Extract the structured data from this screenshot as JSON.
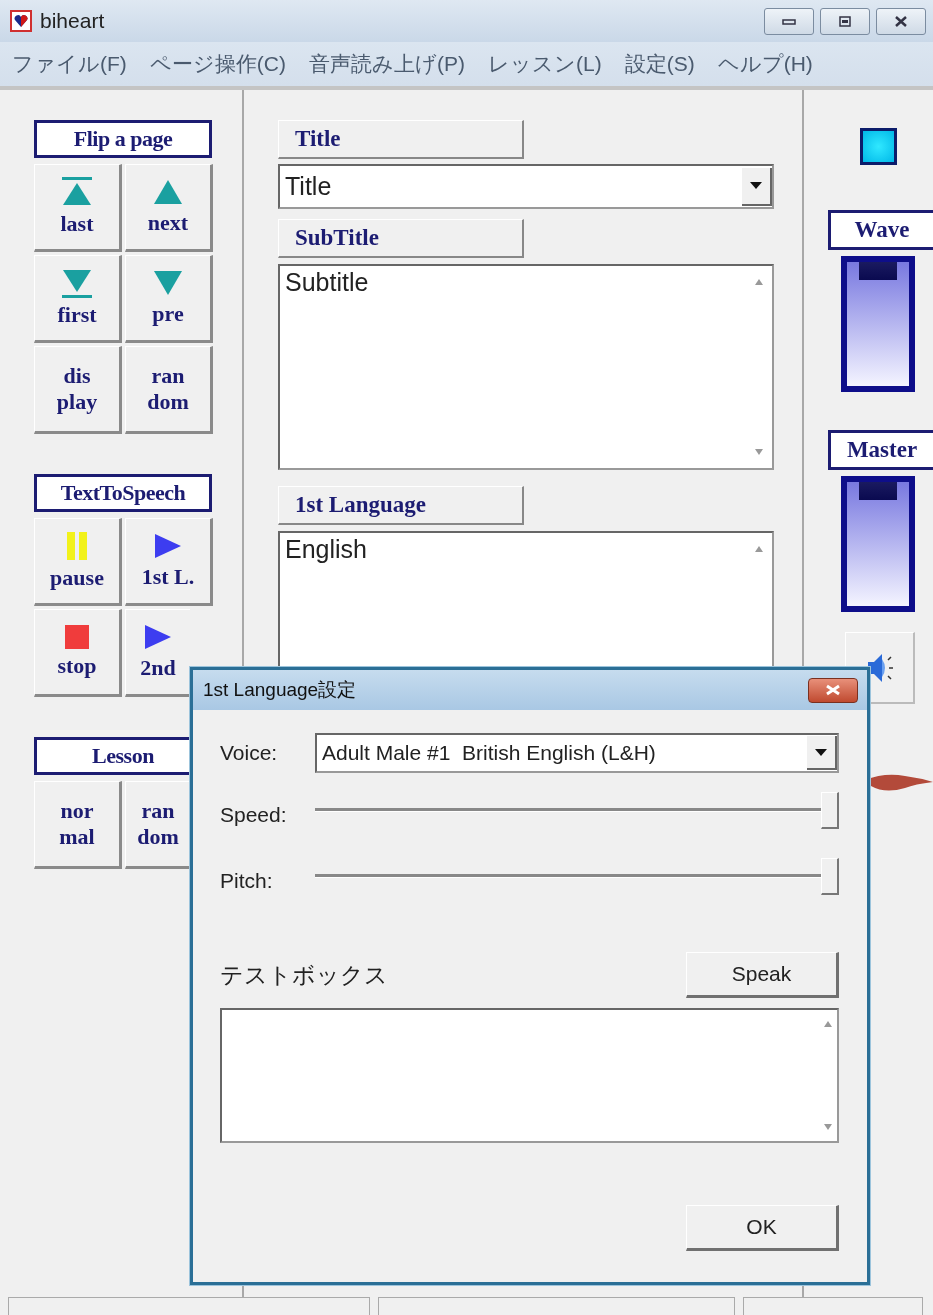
{
  "window": {
    "title": "biheart"
  },
  "menu": [
    "ファイル(F)",
    "ページ操作(C)",
    "音声読み上げ(P)",
    "レッスン(L)",
    "設定(S)",
    "ヘルプ(H)"
  ],
  "left_panel": {
    "groups": [
      {
        "title": "Flip a page",
        "buttons": [
          {
            "label": "last",
            "kind": "top"
          },
          {
            "label": "next",
            "kind": "up"
          },
          {
            "label": "first",
            "kind": "bottom"
          },
          {
            "label": "pre",
            "kind": "down"
          },
          {
            "label": "dis\nplay",
            "kind": "text"
          },
          {
            "label": "ran\ndom",
            "kind": "text"
          }
        ]
      },
      {
        "title": "TextToSpeech",
        "buttons": [
          {
            "label": "pause",
            "kind": "pause"
          },
          {
            "label": "1st L.",
            "kind": "play"
          },
          {
            "label": "stop",
            "kind": "stop"
          },
          {
            "label": "2nd",
            "kind": "play"
          }
        ]
      },
      {
        "title": "Lesson",
        "buttons": [
          {
            "label": "nor\nmal",
            "kind": "text"
          },
          {
            "label": "ran\ndom",
            "kind": "text"
          }
        ]
      }
    ]
  },
  "center": {
    "title_label": "Title",
    "title_combo": {
      "value": "Title"
    },
    "subtitle_label": "SubTitle",
    "subtitle_field": {
      "value": "Subtitle"
    },
    "language_label": "1st Language",
    "language_field": {
      "value": "English"
    }
  },
  "right_panel": {
    "sliders": [
      {
        "label": "Wave",
        "level": 1
      },
      {
        "label": "Master",
        "level": 1
      }
    ]
  },
  "dialog": {
    "title": "1st Language設定",
    "voice_label": "Voice:",
    "voice_value": "Adult Male #1  British English (L&H)",
    "sliders": [
      {
        "label": "Speed:",
        "level": 1
      },
      {
        "label": "Pitch:",
        "level": 1
      }
    ],
    "test_label": "テストボックス",
    "speak_button": "Speak",
    "ok_button": "OK"
  }
}
